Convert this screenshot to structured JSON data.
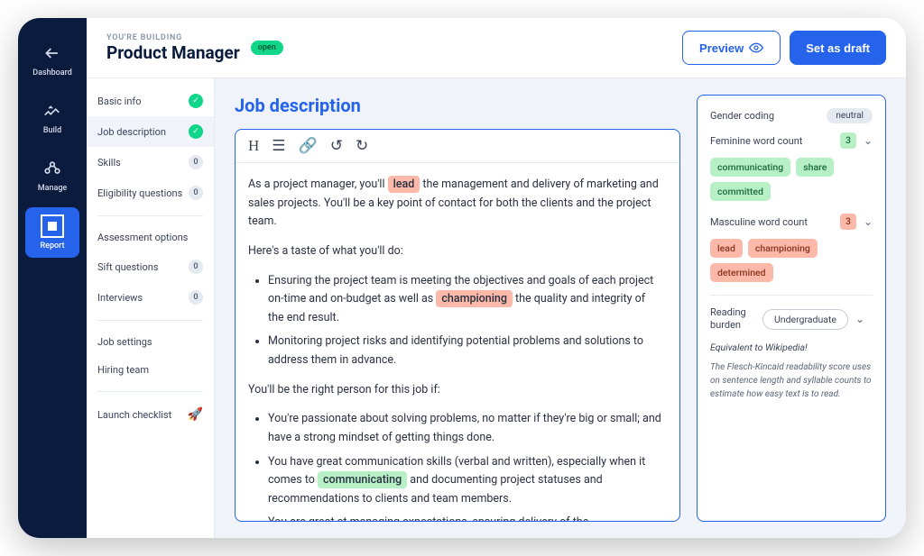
{
  "sidenav": {
    "items": [
      {
        "label": "Dashboard"
      },
      {
        "label": "Build"
      },
      {
        "label": "Manage"
      },
      {
        "label": "Report"
      }
    ]
  },
  "topbar": {
    "eyebrow": "YOU'RE BUILDING",
    "title": "Product Manager",
    "status": "open",
    "preview": "Preview",
    "draft": "Set as draft"
  },
  "steps": {
    "basic_info": "Basic info",
    "job_description": "Job description",
    "skills": "Skills",
    "skills_count": "0",
    "eligibility": "Eligibility questions",
    "eligibility_count": "0",
    "assessment": "Assessment options",
    "sift": "Sift questions",
    "sift_count": "0",
    "interviews": "Interviews",
    "interviews_count": "0",
    "job_settings": "Job settings",
    "hiring_team": "Hiring team",
    "launch": "Launch checklist"
  },
  "page": {
    "title": "Job description"
  },
  "jd": {
    "p1_a": "As a project manager, you'll ",
    "p1_hl1": "lead",
    "p1_b": " the management and delivery of marketing and sales projects. You'll be a key point of contact for both the clients and the project team.",
    "p2": "Here's a taste of what you'll do:",
    "li1_a": "Ensuring the project team is meeting the objectives and goals of each project on-time and on-budget as well as ",
    "li1_hl": "championing",
    "li1_b": " the quality and integrity of the end result.",
    "li2": "Monitoring project risks and identifying potential problems and solutions to address them in advance.",
    "p3": "You'll be the right person for this job if:",
    "li3": "You're passionate about solving problems, no matter if they're big or small; and have a strong mindset of getting things done.",
    "li4_a": "You have great communication skills (verbal and written), especially when it comes to ",
    "li4_hl": "communicating",
    "li4_b": " and documenting project statuses and recommendations to clients and team members.",
    "li5": "You are great at managing expectations, ensuring delivery of the"
  },
  "analysis": {
    "gender_label": "Gender coding",
    "gender_value": "neutral",
    "fem_label": "Feminine word count",
    "fem_count": "3",
    "fem_words": [
      "communicating",
      "share",
      "committed"
    ],
    "masc_label": "Masculine word count",
    "masc_count": "3",
    "masc_words": [
      "lead",
      "championing",
      "determined"
    ],
    "reading_label": "Reading burden",
    "reading_value": "Undergraduate",
    "reading_note": "Equivalent to Wikipedia!",
    "reading_desc": "The Flesch-Kincaid readability score uses on sentence length and syllable counts to estimate how easy text is to read."
  }
}
